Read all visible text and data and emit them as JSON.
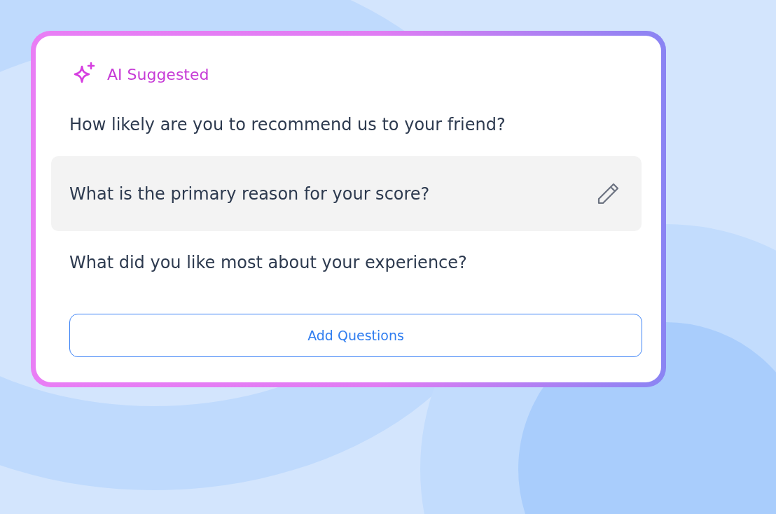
{
  "card": {
    "header": "AI Suggested",
    "questions": [
      {
        "text": "How likely are you to recommend us to your friend?",
        "selected": false
      },
      {
        "text": "What is the primary reason for your score?",
        "selected": true
      },
      {
        "text": "What did you like most about your experience?",
        "selected": false
      }
    ],
    "button": "Add Questions"
  }
}
